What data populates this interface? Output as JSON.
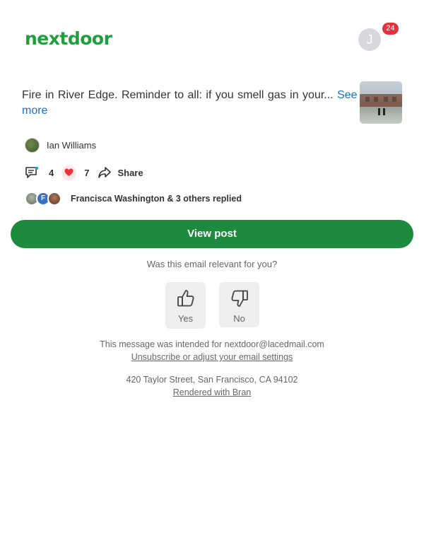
{
  "header": {
    "logo_text": "nextdoor",
    "avatar_initial": "J",
    "notification_count": "24"
  },
  "post": {
    "text": "Fire in River Edge. Reminder to all: if you smell gas in your...",
    "see_more": "See more",
    "author": "Ian Williams",
    "comment_count": "4",
    "reaction_count": "7",
    "share_label": "Share",
    "reply_avatar_initial": "F",
    "replies_text": "Francisca Washington & 3 others replied"
  },
  "cta": {
    "view_post": "View post"
  },
  "feedback": {
    "question": "Was this email relevant for you?",
    "yes": "Yes",
    "no": "No"
  },
  "footer": {
    "intended_for": "This message was intended for nextdoor@lacedmail.com",
    "unsubscribe": "Unsubscribe or adjust your email settings",
    "address": "420 Taylor Street, San Francisco, CA 94102",
    "rendered_with": "Rendered with Bran"
  },
  "colors": {
    "brand_green": "#1d9f3c",
    "button_green": "#1e8a3e",
    "link_blue": "#1a6fc9",
    "badge_red": "#e0313c"
  }
}
